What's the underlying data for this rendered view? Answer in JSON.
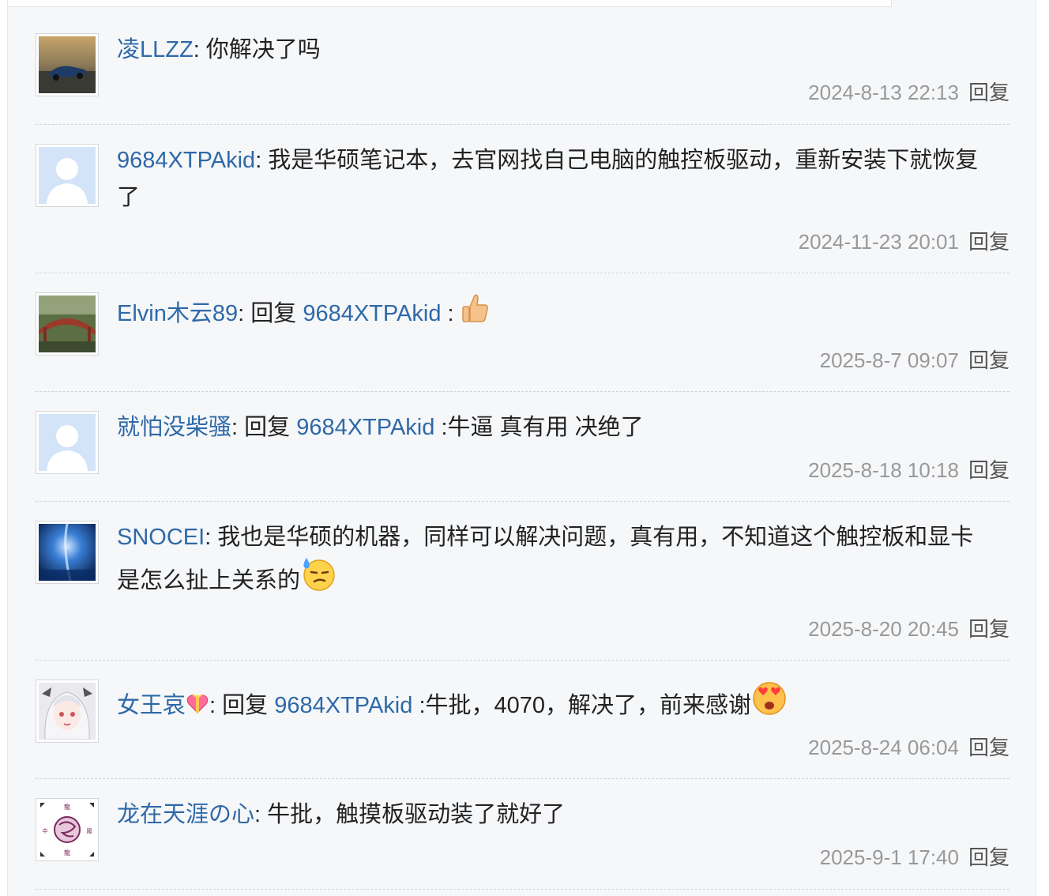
{
  "colors": {
    "panel_bg": "#f6f7f9",
    "author_link": "#2e69a8",
    "meta_text": "#999999",
    "reply_link": "#555555"
  },
  "comments": [
    {
      "author": "凌LLZZ",
      "sep": ":",
      "text": " 你解决了吗",
      "time": "2024-8-13 22:13",
      "reply": "回复",
      "avatar": "car-photo"
    },
    {
      "author": "9684XTPAkid",
      "sep": ":",
      "text": " 我是华硕笔记本，去官网找自己电脑的触控板驱动，重新安装下就恢复了",
      "time": "2024-11-23 20:01",
      "reply": "回复",
      "avatar": "default-user"
    },
    {
      "author": "Elvin木云89",
      "sep": ":",
      "reply_prefix": " 回复 ",
      "reply_to": "9684XTPAkid",
      "text": " :",
      "emoji": "thumbs-up-icon",
      "time": "2025-8-7 09:07",
      "reply": "回复",
      "avatar": "bridge-photo"
    },
    {
      "author": "就怕没柴骚",
      "sep": ":",
      "reply_prefix": " 回复 ",
      "reply_to": "9684XTPAkid",
      "text": " :牛逼 真有用 决绝了",
      "time": "2025-8-18 10:18",
      "reply": "回复",
      "avatar": "default-user"
    },
    {
      "author": "SNOCEI",
      "sep": ":",
      "text": " 我也是华硕的机器，同样可以解决问题，真有用，不知道这个触控板和显卡是怎么扯上关系的",
      "emoji": "sweat-smile-icon",
      "time": "2025-8-20 20:45",
      "reply": "回复",
      "avatar": "galaxy-photo"
    },
    {
      "author": "女王哀",
      "author_emoji": "heart-gift-icon",
      "sep": ":",
      "reply_prefix": " 回复 ",
      "reply_to": "9684XTPAkid",
      "text": " :牛批，4070，解决了，前来感谢",
      "emoji": "heart-eyes-icon",
      "time": "2025-8-24 06:04",
      "reply": "回复",
      "avatar": "anime-girl"
    },
    {
      "author": "龙在天涯の心",
      "sep": ":",
      "text": " 牛批，触摸板驱动装了就好了",
      "time": "2025-9-1 17:40",
      "reply": "回复",
      "avatar": "dragon-emblem"
    }
  ]
}
